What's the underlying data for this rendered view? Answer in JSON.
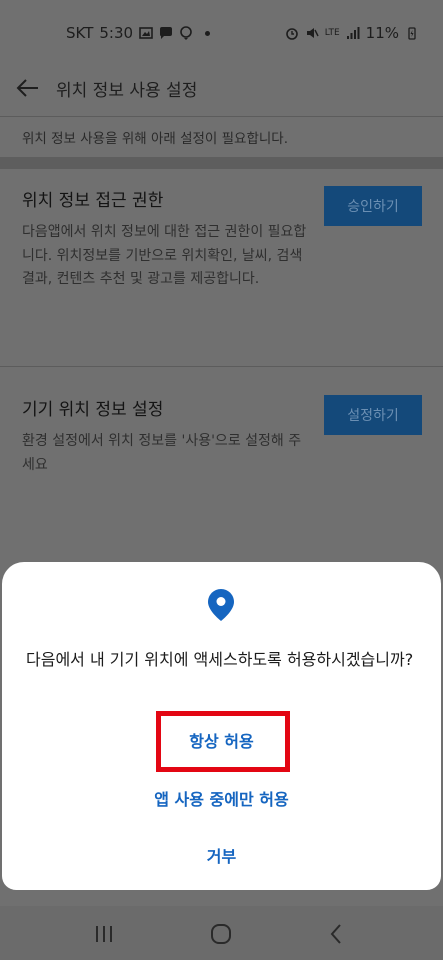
{
  "status_bar": {
    "carrier": "SKT",
    "time": "5:30",
    "network": "LTE",
    "battery": "11%"
  },
  "app_bar": {
    "title": "위치 정보 사용 설정"
  },
  "notice": "위치 정보 사용을 위해 아래 설정이 필요합니다.",
  "permission_section": {
    "title": "위치 정보 접근 권한",
    "description": "다음앱에서 위치 정보에 대한 접근 권한이 필요합니다. 위치정보를 기반으로 위치확인, 날씨, 검색결과, 컨텐츠 추천 및 광고를 제공합니다.",
    "button": "승인하기"
  },
  "device_section": {
    "title": "기기 위치 정보 설정",
    "description": "환경 설정에서 위치 정보를 '사용'으로 설정해 주세요",
    "button": "설정하기"
  },
  "dialog": {
    "message": "다음에서 내 기기 위치에 액세스하도록 허용하시겠습니까?",
    "option_always": "항상 허용",
    "option_while_using": "앱 사용 중에만 허용",
    "option_deny": "거부",
    "accent_color": "#1565c0",
    "highlight_color": "#e30613"
  },
  "nav_bar": {
    "icons": [
      "recent-apps-icon",
      "home-icon",
      "back-icon"
    ]
  }
}
